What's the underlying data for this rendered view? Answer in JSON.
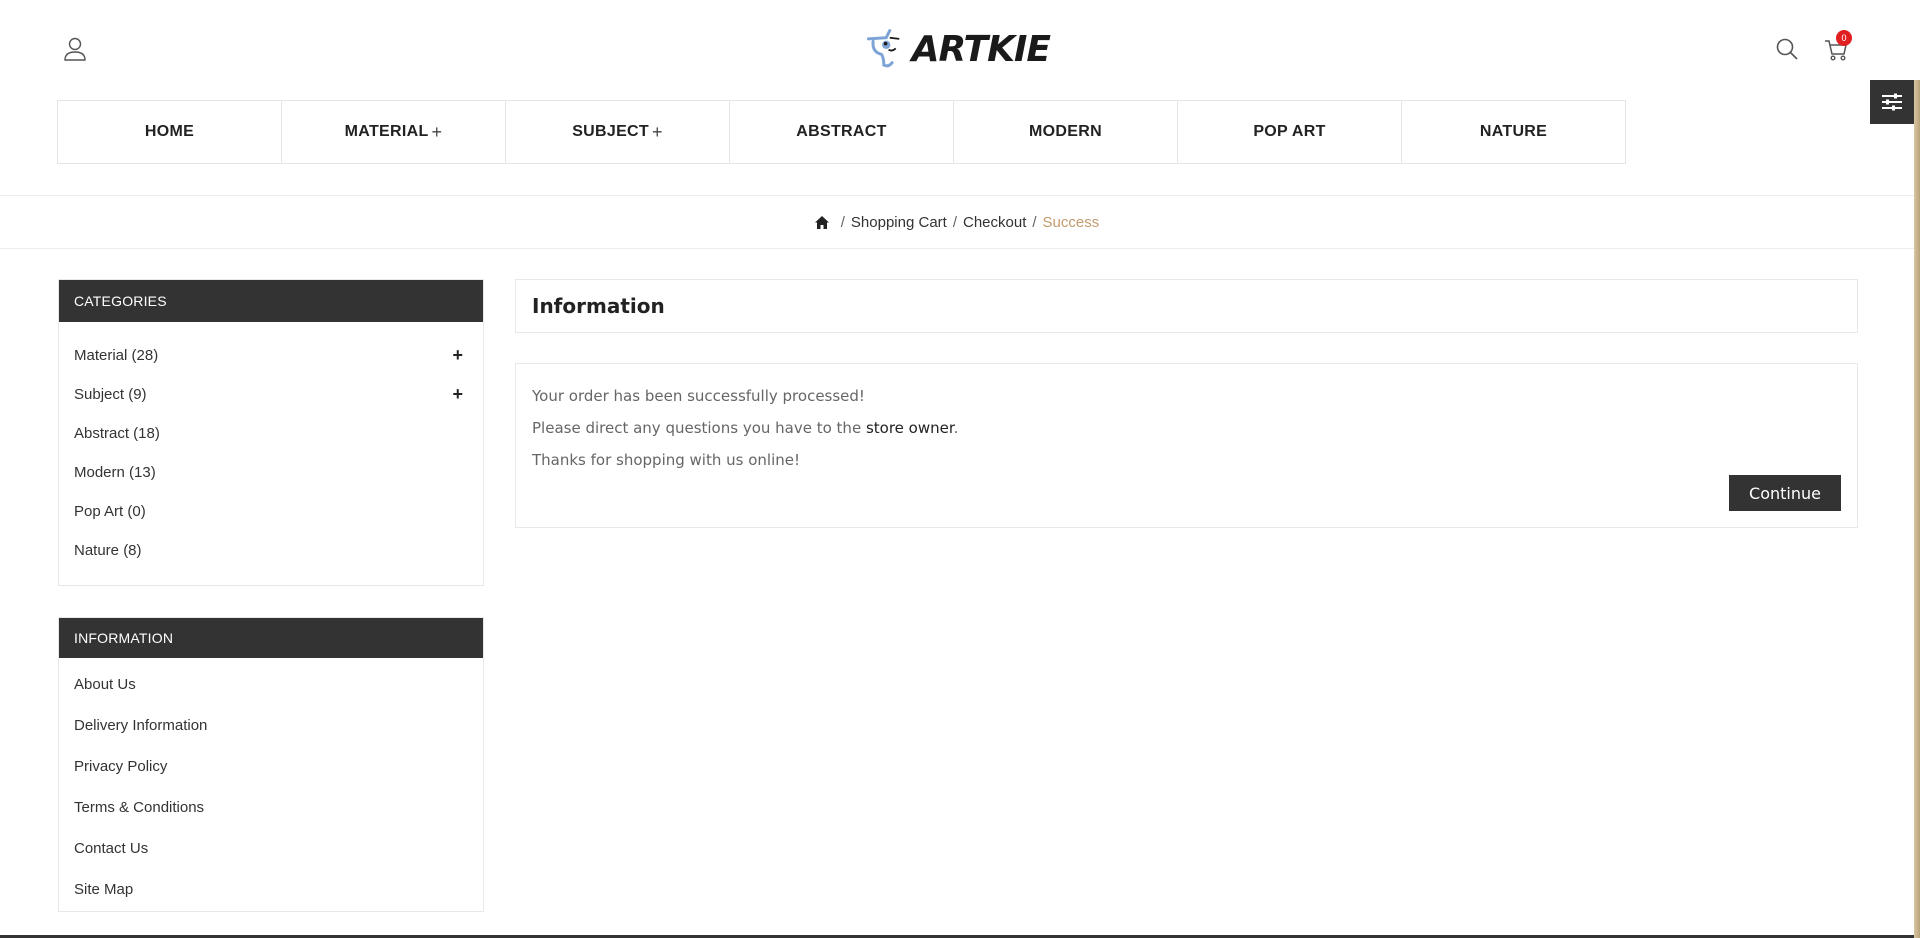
{
  "header": {
    "logo_text": "ARTKIE",
    "cart_count": "0"
  },
  "nav": {
    "items": [
      {
        "label": "HOME",
        "plus": ""
      },
      {
        "label": "MATERIAL",
        "plus": "+"
      },
      {
        "label": "SUBJECT",
        "plus": "+"
      },
      {
        "label": "ABSTRACT",
        "plus": ""
      },
      {
        "label": "MODERN",
        "plus": ""
      },
      {
        "label": "POP ART",
        "plus": ""
      },
      {
        "label": "NATURE",
        "plus": ""
      }
    ]
  },
  "breadcrumb": {
    "items": [
      "Shopping Cart",
      "Checkout"
    ],
    "separator": "/",
    "current": "Success"
  },
  "sidebar": {
    "categories_title": "CATEGORIES",
    "categories": [
      {
        "label": "Material (28)",
        "expand": "+"
      },
      {
        "label": "Subject (9)",
        "expand": "+"
      },
      {
        "label": "Abstract (18)",
        "expand": ""
      },
      {
        "label": "Modern (13)",
        "expand": ""
      },
      {
        "label": "Pop Art (0)",
        "expand": ""
      },
      {
        "label": "Nature (8)",
        "expand": ""
      }
    ],
    "information_title": "INFORMATION",
    "information": [
      "About Us",
      "Delivery Information",
      "Privacy Policy",
      "Terms & Conditions",
      "Contact Us",
      "Site Map"
    ]
  },
  "main": {
    "title": "Information",
    "message_1": "Your order has been successfully processed!",
    "message_2_prefix": "Please direct any questions you have to the ",
    "message_2_link": "store owner",
    "message_2_suffix": ".",
    "message_3": "Thanks for shopping with us online!",
    "continue_label": "Continue"
  },
  "colors": {
    "dark": "#333333",
    "accent": "#c59a6d",
    "badge": "#e02020",
    "logo_blue": "#7ea3d6"
  }
}
